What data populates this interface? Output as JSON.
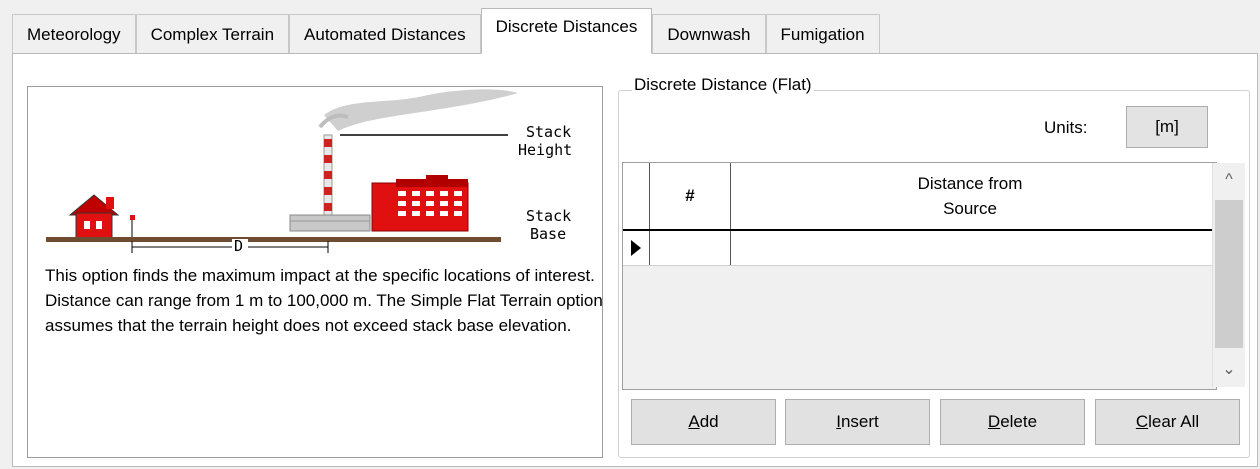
{
  "tabs": [
    {
      "label": "Meteorology",
      "active": false
    },
    {
      "label": "Complex Terrain",
      "active": false
    },
    {
      "label": "Automated Distances",
      "active": false
    },
    {
      "label": "Discrete Distances",
      "active": true
    },
    {
      "label": "Downwash",
      "active": false
    },
    {
      "label": "Fumigation",
      "active": false
    }
  ],
  "diagram": {
    "stack_height_label_1": "Stack",
    "stack_height_label_2": "Height",
    "stack_base_label_1": "Stack",
    "stack_base_label_2": "Base",
    "distance_marker": "D"
  },
  "description": "This option finds the maximum impact at the specific locations of interest. Distance can range from 1 m to 100,000 m.  The Simple Flat Terrain option assumes that the terrain height does not exceed stack base elevation.",
  "group": {
    "title": "Discrete Distance (Flat)",
    "units_label": "Units:",
    "units_value": "[m]"
  },
  "grid": {
    "col_num": "#",
    "col_distance_1": "Distance from",
    "col_distance_2": "Source"
  },
  "buttons": {
    "add_key": "A",
    "add_rest": "dd",
    "insert_key": "I",
    "insert_rest": "nsert",
    "delete_key": "D",
    "delete_rest": "elete",
    "clear_key": "C",
    "clear_rest": "lear All"
  },
  "colors": {
    "house": "#e01010",
    "factory": "#e01010",
    "stack_stripe": "#d02020",
    "smoke": "#c8c8c8"
  }
}
